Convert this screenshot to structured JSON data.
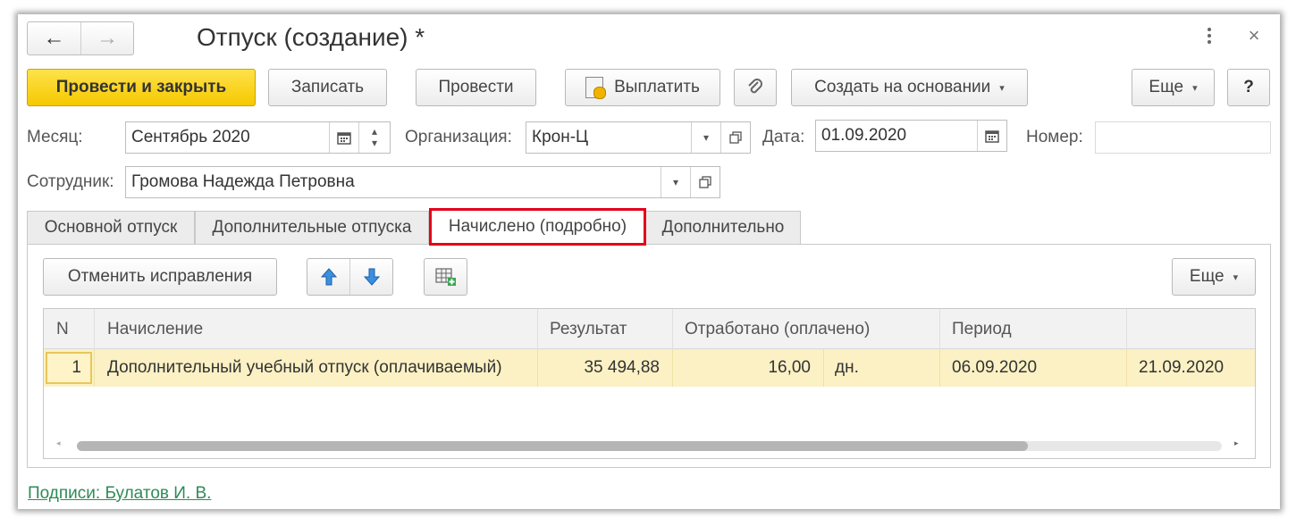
{
  "window": {
    "title": "Отпуск (создание) *"
  },
  "nav": {
    "back": "←",
    "forward": "→"
  },
  "toolbar": {
    "post_close": "Провести и закрыть",
    "save": "Записать",
    "post": "Провести",
    "pay": "Выплатить",
    "create_based": "Создать на основании",
    "more": "Еще",
    "help": "?"
  },
  "form": {
    "month_label": "Месяц:",
    "month_value": "Сентябрь 2020",
    "org_label": "Организация:",
    "org_value": "Крон-Ц",
    "date_label": "Дата:",
    "date_value": "01.09.2020",
    "number_label": "Номер:",
    "number_value": "",
    "employee_label": "Сотрудник:",
    "employee_value": "Громова Надежда Петровна"
  },
  "tabs": [
    {
      "label": "Основной отпуск"
    },
    {
      "label": "Дополнительные отпуска"
    },
    {
      "label": "Начислено (подробно)"
    },
    {
      "label": "Дополнительно"
    }
  ],
  "tab_toolbar": {
    "cancel_fixes": "Отменить исправления",
    "more": "Еще"
  },
  "table": {
    "columns": [
      "N",
      "Начисление",
      "Результат",
      "Отработано (оплачено)",
      "Период",
      ""
    ],
    "rows": [
      {
        "n": "1",
        "accrual": "Дополнительный учебный отпуск (оплачиваемый)",
        "result": "35 494,88",
        "worked": "16,00",
        "unit": "дн.",
        "period_from": "06.09.2020",
        "period_to": "21.09.2020"
      }
    ]
  },
  "footer": {
    "signatures": "Подписи: Булатов И. В."
  },
  "colors": {
    "primary_button": "#f5c800",
    "selected_row": "#fbf1c4",
    "active_tab_border": "#e3001b",
    "link": "#2e8b57"
  }
}
